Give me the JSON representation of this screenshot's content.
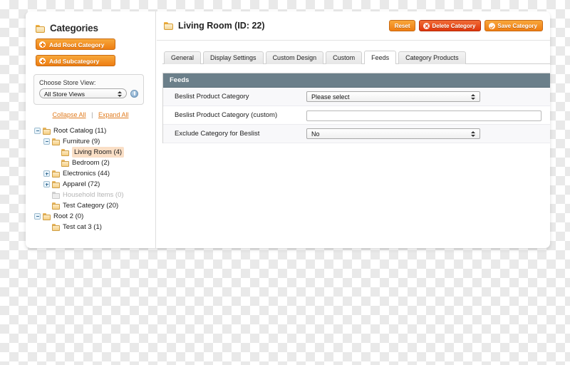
{
  "sidebar": {
    "title": "Categories",
    "buttons": [
      {
        "label": "Add Root Category",
        "name": "add-root-category-button"
      },
      {
        "label": "Add Subcategory",
        "name": "add-subcategory-button"
      }
    ],
    "store_view": {
      "label": "Choose Store View:",
      "value": "All Store Views"
    },
    "collapse_all": "Collapse All",
    "separator": "|",
    "expand_all": "Expand All",
    "tree": [
      {
        "label": "Root Catalog (11)",
        "depth": 0,
        "toggle": "minus",
        "selected": false,
        "dim": false
      },
      {
        "label": "Furniture (9)",
        "depth": 1,
        "toggle": "minus",
        "selected": false,
        "dim": false
      },
      {
        "label": "Living Room (4)",
        "depth": 2,
        "toggle": "none",
        "selected": true,
        "dim": false
      },
      {
        "label": "Bedroom (2)",
        "depth": 2,
        "toggle": "none",
        "selected": false,
        "dim": false
      },
      {
        "label": "Electronics (44)",
        "depth": 1,
        "toggle": "plus",
        "selected": false,
        "dim": false
      },
      {
        "label": "Apparel (72)",
        "depth": 1,
        "toggle": "plus",
        "selected": false,
        "dim": false
      },
      {
        "label": "Household Items (0)",
        "depth": 1,
        "toggle": "none",
        "selected": false,
        "dim": true
      },
      {
        "label": "Test Category (20)",
        "depth": 1,
        "toggle": "none",
        "selected": false,
        "dim": false
      },
      {
        "label": "Root 2 (0)",
        "depth": 0,
        "toggle": "minus",
        "selected": false,
        "dim": false
      },
      {
        "label": "Test cat 3 (1)",
        "depth": 1,
        "toggle": "none",
        "selected": false,
        "dim": false
      }
    ]
  },
  "content": {
    "title": "Living Room (ID: 22)",
    "actions": [
      {
        "label": "Reset",
        "style": "reset",
        "name": "reset-button",
        "icon": false
      },
      {
        "label": "Delete Category",
        "style": "delete",
        "name": "delete-category-button",
        "icon": true
      },
      {
        "label": "Save Category",
        "style": "save",
        "name": "save-category-button",
        "icon": true
      }
    ],
    "tabs": [
      {
        "label": "General",
        "active": false,
        "name": "tab-general"
      },
      {
        "label": "Display Settings",
        "active": false,
        "name": "tab-display-settings"
      },
      {
        "label": "Custom Design",
        "active": false,
        "name": "tab-custom-design"
      },
      {
        "label": "Custom",
        "active": false,
        "name": "tab-custom"
      },
      {
        "label": "Feeds",
        "active": true,
        "name": "tab-feeds"
      },
      {
        "label": "Category Products",
        "active": false,
        "name": "tab-category-products"
      }
    ],
    "fieldset": {
      "legend": "Feeds",
      "rows": [
        {
          "label": "Beslist Product Category",
          "type": "select",
          "value": "Please select",
          "name": "beslist-product-category"
        },
        {
          "label": "Beslist Product Category (custom)",
          "type": "text",
          "value": "",
          "name": "beslist-product-category-custom"
        },
        {
          "label": "Exclude Category for Beslist",
          "type": "select",
          "value": "No",
          "name": "exclude-category-for-beslist"
        }
      ]
    }
  },
  "colors": {
    "orange": "#ef7d12",
    "red": "#e0360d",
    "panel_header": "#6b7f8a",
    "selection": "#fadfc6"
  }
}
